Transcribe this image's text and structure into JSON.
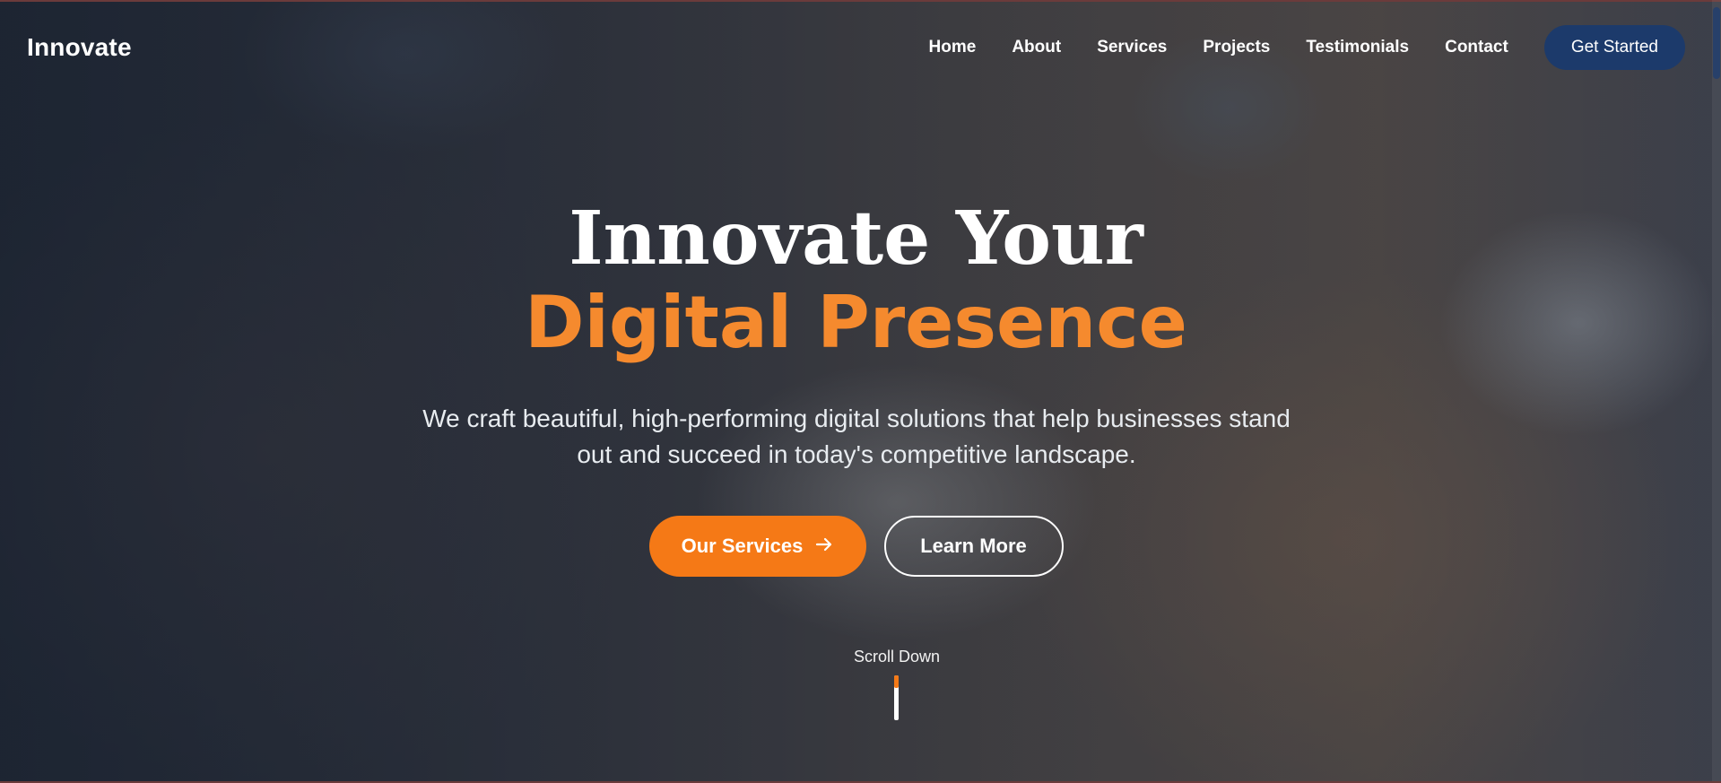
{
  "brand": {
    "name": "Innovate"
  },
  "nav": {
    "links": [
      "Home",
      "About",
      "Services",
      "Projects",
      "Testimonials",
      "Contact"
    ],
    "cta_label": "Get Started"
  },
  "hero": {
    "title_line1": "Innovate Your",
    "title_line2": "Digital Presence",
    "description": "We craft beautiful, high-performing digital solutions that help businesses stand out and succeed in today's competitive landscape.",
    "primary_button": "Our Services",
    "primary_button_icon": "arrow-right-icon",
    "secondary_button": "Learn More",
    "scroll_label": "Scroll Down"
  },
  "colors": {
    "accent": "#f57916",
    "title_accent": "#f58a2e",
    "nav_cta": "#1c3a6b",
    "text": "#ffffff"
  }
}
